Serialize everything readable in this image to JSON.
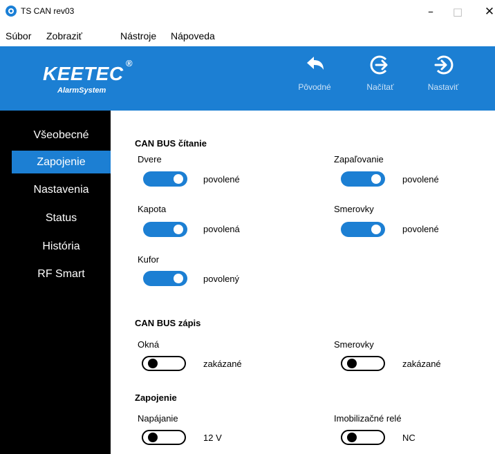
{
  "window": {
    "title": "TS CAN rev03",
    "minimize": "–",
    "maximize": "□",
    "close": "✕"
  },
  "menu": [
    "Súbor",
    "Zobraziť",
    "Nástroje",
    "Nápoveda"
  ],
  "header": {
    "logo": "KEETEC",
    "logo_reg": "®",
    "logo_sub": "AlarmSystem",
    "buttons": [
      {
        "label": "Pôvodné",
        "icon": "undo-arrow-icon"
      },
      {
        "label": "Načítať",
        "icon": "load-arrow-icon"
      },
      {
        "label": "Nastaviť",
        "icon": "set-arrow-icon"
      }
    ],
    "accent_color": "#1c7fd3"
  },
  "sidebar": {
    "items": [
      "Všeobecné",
      "Zapojenie",
      "Nastavenia",
      "Status",
      "História",
      "RF Smart"
    ],
    "active_index": 1
  },
  "main": {
    "sections": {
      "read": "CAN BUS čítanie",
      "write": "CAN BUS zápis",
      "wiring": "Zapojenie"
    },
    "fields": {
      "dvere": {
        "label": "Dvere",
        "on": true,
        "state": "povolené"
      },
      "zapalovanie": {
        "label": "Zapaľovanie",
        "on": true,
        "state": "povolené"
      },
      "kapota": {
        "label": "Kapota",
        "on": true,
        "state": "povolená"
      },
      "smerovky_read": {
        "label": "Smerovky",
        "on": true,
        "state": "povolené"
      },
      "kufor": {
        "label": "Kufor",
        "on": true,
        "state": "povolený"
      },
      "okna": {
        "label": "Okná",
        "on": false,
        "state": "zakázané"
      },
      "smerovky_write": {
        "label": "Smerovky",
        "on": false,
        "state": "zakázané"
      },
      "napajanie": {
        "label": "Napájanie",
        "on": false,
        "state": "12 V"
      },
      "imobilizacne": {
        "label": "Imobilizačné relé",
        "on": false,
        "state": "NC"
      }
    }
  }
}
